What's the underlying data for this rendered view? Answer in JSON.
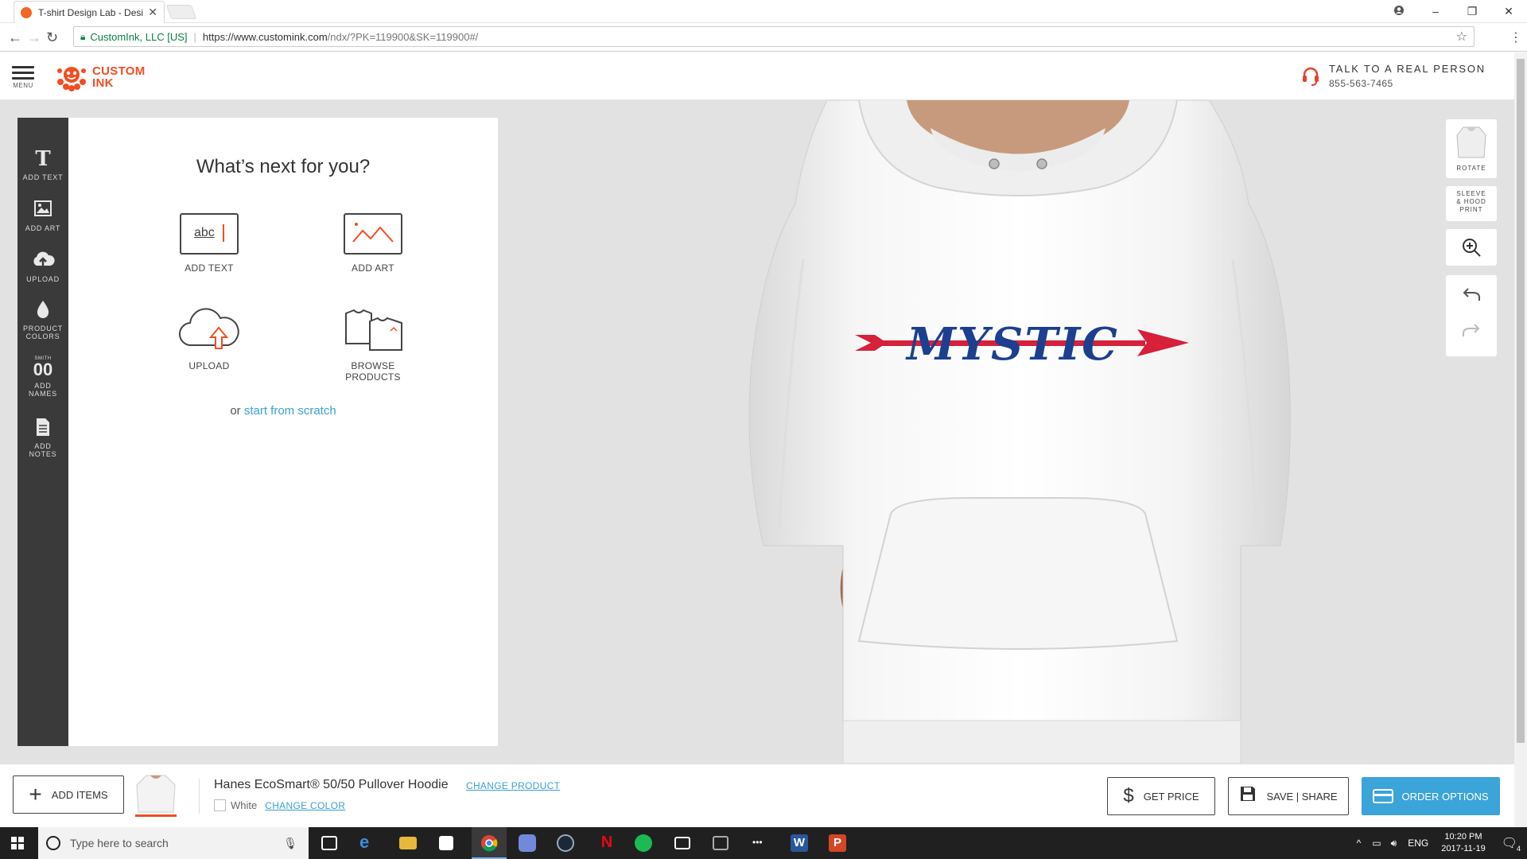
{
  "browser": {
    "tab_title": "T-shirt Design Lab - Desi",
    "tab_close": "✕",
    "secure_label": "CustomInk, LLC [US]",
    "url_main": "https://www.customink.com",
    "url_rest": "/ndx/?PK=119900&SK=119900#/"
  },
  "header": {
    "menu_label": "MENU",
    "logo_line1": "CUSTOM",
    "logo_line2": "INK",
    "talk_title": "TALK TO A REAL PERSON",
    "talk_phone": "855-563-7465"
  },
  "rail": {
    "items": [
      {
        "icon": "T",
        "label": "ADD TEXT"
      },
      {
        "icon": "",
        "label": "ADD ART"
      },
      {
        "icon": "",
        "label": "UPLOAD"
      },
      {
        "icon": "",
        "label": "PRODUCT COLORS"
      },
      {
        "icon": "00",
        "label": "ADD NAMES"
      },
      {
        "icon": "",
        "label": "ADD NOTES"
      }
    ],
    "names_top": "SMITH"
  },
  "panel": {
    "title": "What’s next for you?",
    "options": [
      {
        "label": "ADD TEXT",
        "glyph": "abc"
      },
      {
        "label": "ADD ART"
      },
      {
        "label": "UPLOAD"
      },
      {
        "label": "BROWSE PRODUCTS"
      }
    ],
    "scratch_prefix": "or",
    "scratch_link": "start from scratch"
  },
  "design": {
    "text": "MYSTIC",
    "text_color": "#1c3f8f",
    "arrow_color": "#d7203a"
  },
  "right_tools": {
    "rotate": "ROTATE",
    "sleeve": "SLEEVE & HOOD PRINT"
  },
  "bottom": {
    "add_items": "ADD ITEMS",
    "product_name": "Hanes EcoSmart® 50/50 Pullover Hoodie",
    "change_product": "CHANGE PRODUCT",
    "color_name": "White",
    "change_color": "CHANGE COLOR",
    "get_price": "GET PRICE",
    "save_share": "SAVE | SHARE",
    "order_options": "ORDER OPTIONS"
  },
  "taskbar": {
    "search_placeholder": "Type here to search",
    "lang": "ENG",
    "time": "10:20 PM",
    "date": "2017-11-19",
    "notif_count": "4"
  },
  "colors": {
    "accent": "#3ba4d9",
    "brand": "#f04e23",
    "rail_bg": "#3a3a3a"
  }
}
